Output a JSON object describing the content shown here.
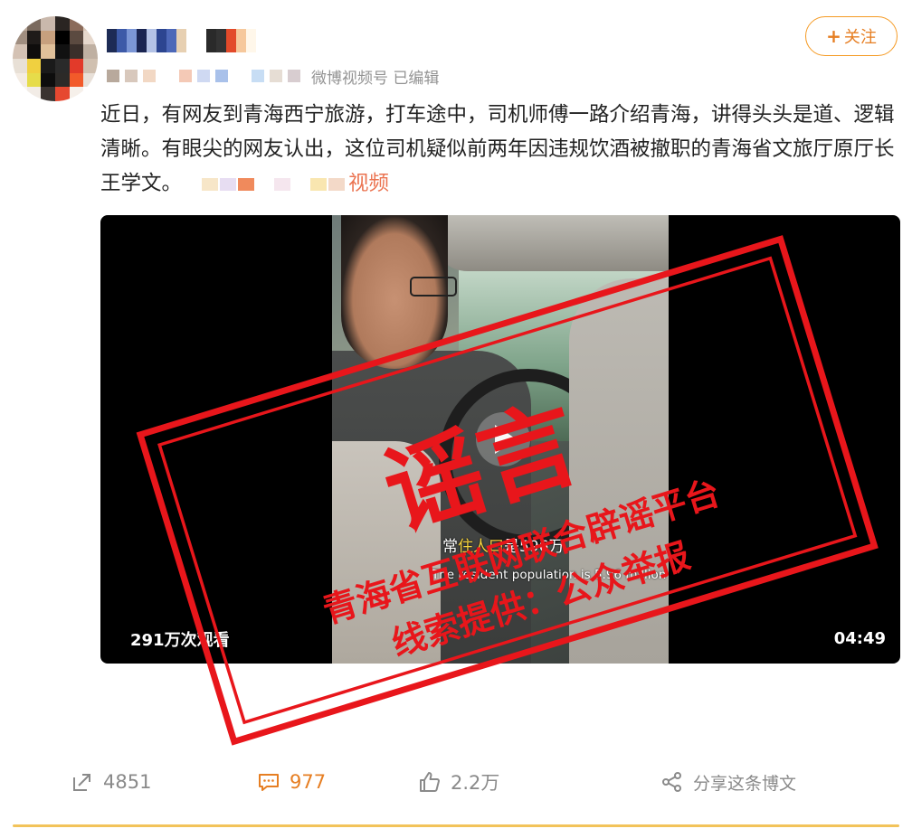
{
  "post": {
    "meta_source": "微博视频号 已编辑",
    "follow_label": "关注",
    "text_main": "近日，有网友到青海西宁旅游，打车途中，司机师傅一路介绍青海，讲得头头是道、逻辑清晰。有眼尖的网友认出，这位司机疑似前两年因违规饮酒被撤职的青海省文旅厅原厅长王学文。",
    "text_link": "视频"
  },
  "video": {
    "subtitle_cn_prefix": "常",
    "subtitle_cn_highlight": "住人口",
    "subtitle_cn_suffix": "是596万",
    "subtitle_en": "The resident population is 5.96 million",
    "views": "291万次观看",
    "duration": "04:49"
  },
  "stamp": {
    "main_text": "谣言",
    "line1": "青海省互联网联合辟谣平台",
    "line2": "线索提供：公众举报",
    "color": "#e8161b"
  },
  "actions": {
    "repost_count": "4851",
    "comment_count": "977",
    "like_count": "2.2万",
    "share_label": "分享这条博文"
  },
  "colors": {
    "accent": "#e67e22",
    "link": "#eb7350"
  },
  "icons": [
    "repost-icon",
    "comment-icon",
    "like-icon",
    "share-icon",
    "play-icon"
  ]
}
